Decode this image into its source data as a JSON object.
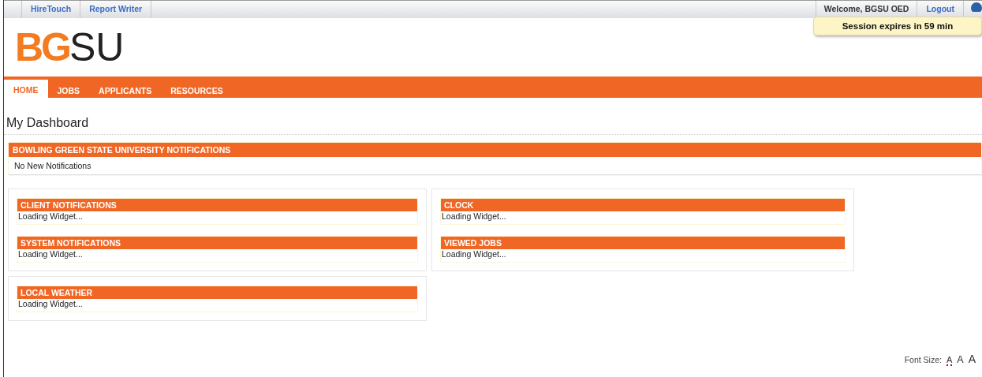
{
  "top_links": [
    {
      "label": "HireTouch"
    },
    {
      "label": "Report Writer"
    }
  ],
  "user_bar": {
    "welcome": "Welcome, BGSU OED",
    "logout": "Logout"
  },
  "session_notice": "Session expires in 59 min",
  "logo": {
    "bold": "BG",
    "light": "SU"
  },
  "nav": [
    {
      "label": "HOME",
      "selected": true
    },
    {
      "label": "JOBS",
      "selected": false
    },
    {
      "label": "APPLICANTS",
      "selected": false
    },
    {
      "label": "RESOURCES",
      "selected": false
    }
  ],
  "page_title": "My Dashboard",
  "university_panel": {
    "title": "BOWLING GREEN STATE UNIVERSITY NOTIFICATIONS",
    "body": "No New Notifications"
  },
  "panels": [
    {
      "widgets": [
        {
          "title": "CLIENT NOTIFICATIONS",
          "body": "Loading Widget..."
        },
        {
          "title": "SYSTEM NOTIFICATIONS",
          "body": "Loading Widget..."
        }
      ]
    },
    {
      "widgets": [
        {
          "title": "CLOCK",
          "body": "Loading Widget..."
        },
        {
          "title": "VIEWED JOBS",
          "body": "Loading Widget..."
        }
      ]
    },
    {
      "widgets": [
        {
          "title": "LOCAL WEATHER",
          "body": "Loading Widget..."
        }
      ]
    }
  ],
  "font_size": {
    "label": "Font Size:",
    "options": [
      {
        "label": "A",
        "selected": true
      },
      {
        "label": "A",
        "selected": false
      },
      {
        "label": "A",
        "selected": false
      }
    ]
  }
}
